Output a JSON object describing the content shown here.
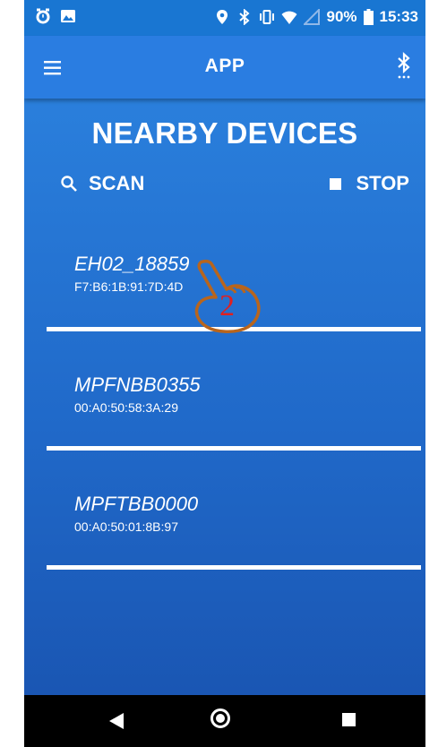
{
  "status_bar": {
    "battery": "90%",
    "time": "15:33"
  },
  "app_bar": {
    "title": "APP"
  },
  "main": {
    "heading": "NEARBY DEVICES",
    "scan_label": "SCAN",
    "stop_label": "STOP"
  },
  "devices": [
    {
      "name": "EH02_18859",
      "mac": "F7:B6:1B:91:7D:4D"
    },
    {
      "name": "MPFNBB0355",
      "mac": "00:A0:50:58:3A:29"
    },
    {
      "name": "MPFTBB0000",
      "mac": "00:A0:50:01:8B:97"
    }
  ],
  "annotation": {
    "step_number": "2"
  },
  "colors": {
    "status_bar": "#1976d2",
    "app_bar": "#2a7de1",
    "content_top": "#2a7fdc",
    "content_bottom": "#1a56b3",
    "annotation": "#b8651d",
    "annotation_number": "#e02020"
  }
}
